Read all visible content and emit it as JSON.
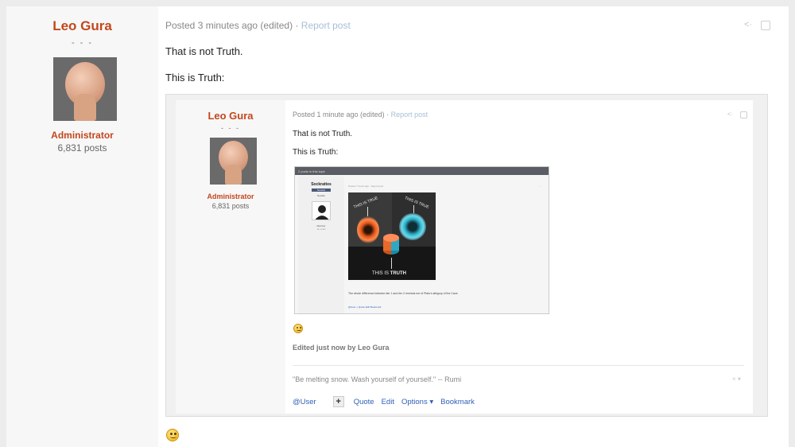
{
  "post": {
    "author": {
      "name": "Leo Gura",
      "dashes": "- - -",
      "role": "Administrator",
      "post_count": "6,831 posts"
    },
    "meta": {
      "posted": "Posted 3 minutes ago (edited)",
      "separator": " · ",
      "report": "Report post"
    },
    "body": {
      "line1": "That is not Truth.",
      "line2": "This is Truth:"
    },
    "embedded_screenshot": {
      "author": {
        "name": "Leo Gura",
        "dashes": "- - -",
        "role": "Administrator",
        "post_count": "6,831 posts"
      },
      "meta": {
        "posted": "Posted 1 minute ago (edited)",
        "separator": " · ",
        "report": "Report post"
      },
      "body": {
        "line1": "That is not Truth.",
        "line2": "This is Truth:"
      },
      "nested_screenshot": {
        "topbar": "2 posts in this topic",
        "author": "Sockrattes",
        "badge": "Neutral",
        "sub": "Newbie",
        "role": "Member",
        "count": "11 posts",
        "posted": "Posted 7 hours ago · Report post",
        "caption": "The whole difference between tier 1 and tier 2 reminds me of Plato's allegory of the Cave.",
        "actions": "@User  +  Quote  Edit  Bookmark",
        "artwork_labels": {
          "left": "THIS IS TRUE",
          "right": "THIS IS TRUE",
          "bottom_prefix": "THIS IS ",
          "bottom_bold": "TRUTH"
        }
      },
      "edited_note": "Edited just now by Leo Gura",
      "signature": "\"Be melting snow. Wash yourself of yourself.\" -- Rumi",
      "actions": {
        "user": "@User",
        "plus": "+",
        "quote": "Quote",
        "edit": "Edit",
        "options": "Options ▾",
        "bookmark": "Bookmark"
      }
    }
  }
}
